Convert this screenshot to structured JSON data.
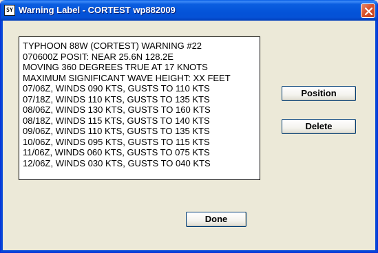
{
  "window": {
    "title": "Warning Label - CORTEST wp882009",
    "icon_text": "SY"
  },
  "warning_text": {
    "lines": [
      "TYPHOON 88W (CORTEST) WARNING #22",
      "070600Z POSIT: NEAR 25.6N 128.2E",
      "MOVING 360 DEGREES TRUE AT 17 KNOTS",
      "MAXIMUM SIGNIFICANT WAVE HEIGHT: XX FEET",
      "07/06Z, WINDS 090 KTS, GUSTS TO 110 KTS",
      "07/18Z, WINDS 110 KTS, GUSTS TO 135 KTS",
      "08/06Z, WINDS 130 KTS, GUSTS TO 160 KTS",
      "08/18Z, WINDS 115 KTS, GUSTS TO 140 KTS",
      "09/06Z, WINDS 110 KTS, GUSTS TO 135 KTS",
      "10/06Z, WINDS 095 KTS, GUSTS TO 115 KTS",
      "11/06Z, WINDS 060 KTS, GUSTS TO 075 KTS",
      "12/06Z, WINDS 030 KTS, GUSTS TO 040 KTS"
    ]
  },
  "buttons": {
    "position_label": "Position",
    "delete_label": "Delete",
    "done_label": "Done"
  },
  "colors": {
    "titlebar": "#0453d8",
    "window_bg": "#ece9d8",
    "close_button": "#d9532d"
  },
  "icons": {
    "app": "app-icon",
    "close": "close-icon"
  }
}
